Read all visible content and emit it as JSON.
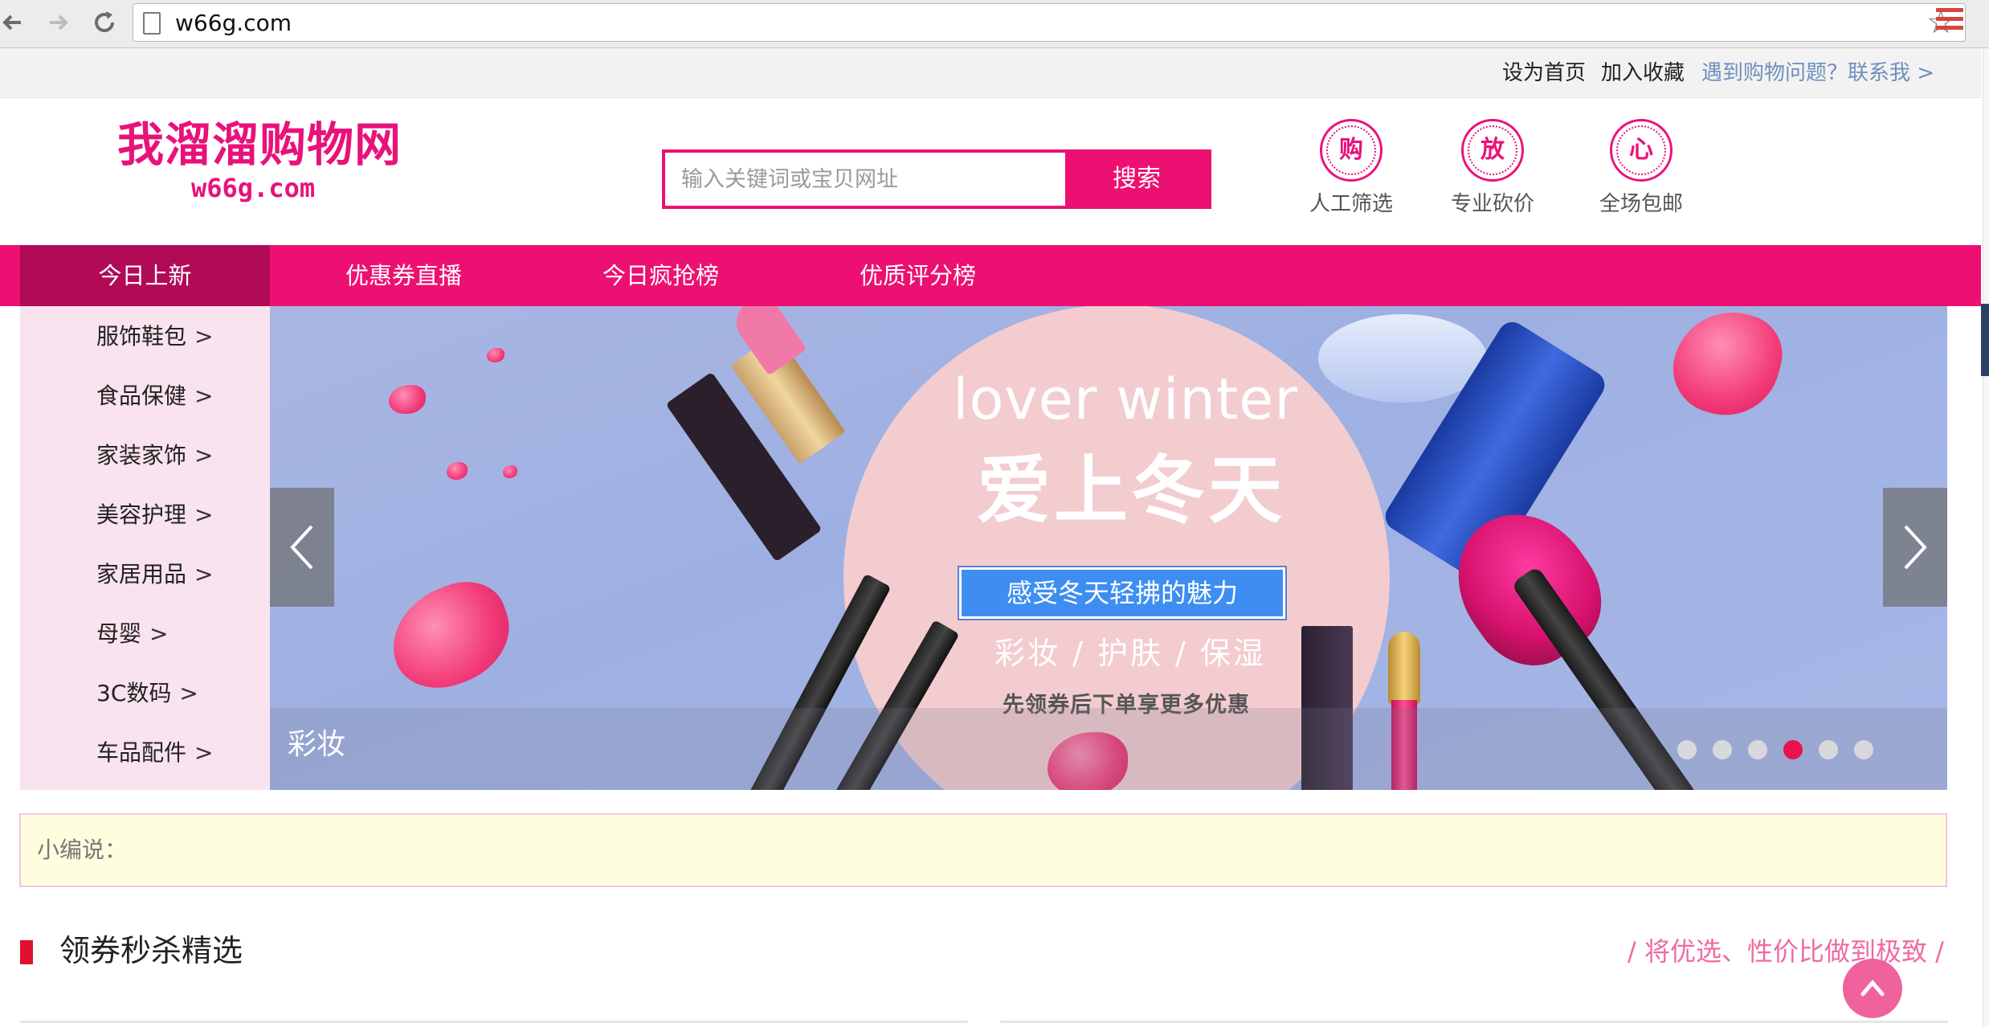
{
  "browser": {
    "url": "w66g.com",
    "icons": [
      "back-arrow-icon",
      "forward-arrow-icon",
      "reload-icon",
      "page-icon",
      "star-icon",
      "menu-icon"
    ]
  },
  "topbar": {
    "set_home": "设为首页",
    "add_favorite": "加入收藏",
    "help_link": "遇到购物问题？联系我 >"
  },
  "header": {
    "logo_cn": "我溜溜购物网",
    "logo_en": "w66g.com",
    "search": {
      "placeholder": "输入关键词或宝贝网址",
      "value": "",
      "button": "搜索"
    },
    "features": [
      {
        "badge": "购",
        "label": "人工筛选"
      },
      {
        "badge": "放",
        "label": "专业砍价"
      },
      {
        "badge": "心",
        "label": "全场包邮"
      }
    ]
  },
  "nav": {
    "items": [
      "今日上新",
      "优惠券直播",
      "今日疯抢榜",
      "优质评分榜"
    ],
    "active_index": 0
  },
  "sidebar": {
    "categories": [
      {
        "label": "服饰鞋包",
        "arrow": ">"
      },
      {
        "label": "食品保健",
        "arrow": ">"
      },
      {
        "label": "家装家饰",
        "arrow": ">"
      },
      {
        "label": "美容护理",
        "arrow": ">"
      },
      {
        "label": "家居用品",
        "arrow": ">"
      },
      {
        "label": "母婴",
        "arrow": ">"
      },
      {
        "label": "3C数码",
        "arrow": ">"
      },
      {
        "label": "车品配件",
        "arrow": ">"
      }
    ]
  },
  "banner": {
    "headline_en": "lover winter",
    "headline_cn": "爱上冬天",
    "pill": "感受冬天轻拂的魅力",
    "subline": "彩妆 / 护肤 / 保湿",
    "promo": "先领券后下单享更多优惠",
    "caption": "彩妆",
    "slide_count": 6,
    "active_slide": 4
  },
  "editor_note": {
    "label": "小编说："
  },
  "section": {
    "title": "领券秒杀精选",
    "slogan": "/ 将优选、性价比做到极致 /"
  },
  "colors": {
    "brand_pink": "#ec1072",
    "nav_active": "#b10b57",
    "sidebar_bg": "#f9e3ee",
    "link_blue": "#6f8fbf",
    "note_bg": "#fefedf",
    "section_bar": "#e0102e",
    "back_to_top": "#f0629c"
  }
}
